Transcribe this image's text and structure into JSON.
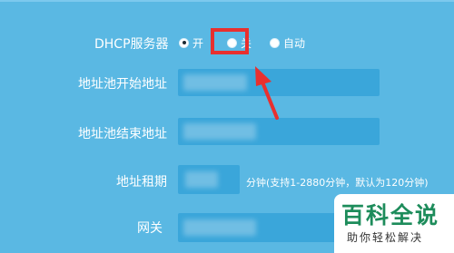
{
  "form": {
    "dhcp_label": "DHCP服务器",
    "radio_options": [
      "开",
      "关",
      "自动"
    ],
    "selected_option": "开",
    "start_label": "地址池开始地址",
    "end_label": "地址池结束地址",
    "lease_label": "地址租期",
    "lease_hint": "分钟(支持1-2880分钟，默认为120分钟)",
    "gateway_label": "网关"
  },
  "watermark": {
    "title": "百科全说",
    "subtitle": "助你轻松解决"
  },
  "colors": {
    "background": "#5ab8e3",
    "field": "#3aa6da",
    "highlight": "#e8302f",
    "watermark_green": "#1d8c5b"
  }
}
